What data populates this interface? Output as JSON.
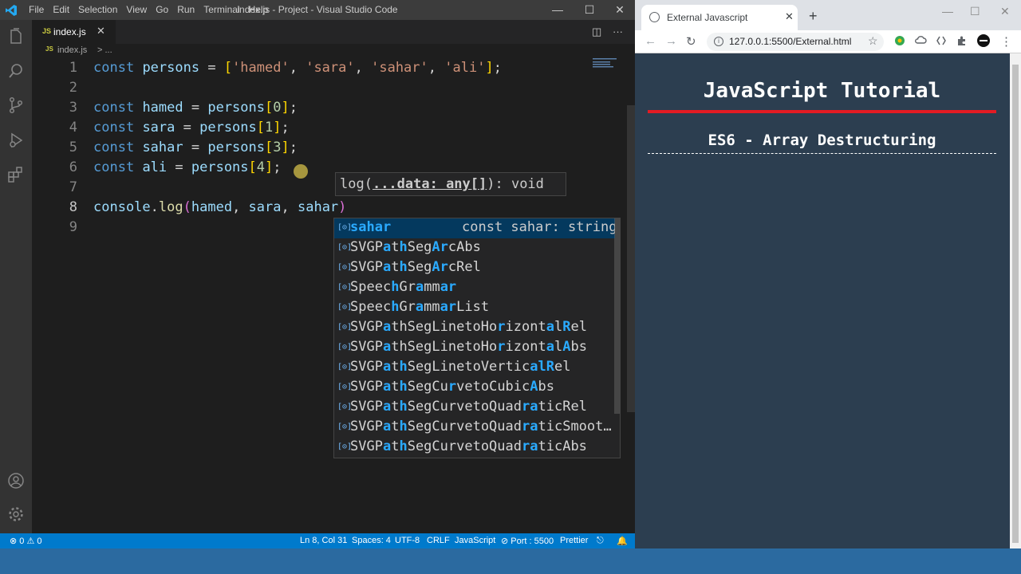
{
  "vscode": {
    "menu": [
      "File",
      "Edit",
      "Selection",
      "View",
      "Go",
      "Run",
      "Terminal",
      "Help"
    ],
    "window_title": "index.js - Project - Visual Studio Code",
    "tab": {
      "icon": "JS",
      "name": "index.js",
      "close": "✕"
    },
    "breadcrumb": {
      "icon": "JS",
      "file": "index.js",
      "sep": "> ..."
    },
    "line_numbers": [
      "1",
      "2",
      "3",
      "4",
      "5",
      "6",
      "7",
      "8",
      "9"
    ],
    "code": {
      "line1": {
        "kw": "const",
        "var": "persons",
        "eq": " = ",
        "open": "[",
        "s1": "'hamed'",
        "s2": "'sara'",
        "s3": "'sahar'",
        "s4": "'ali'",
        "close": "]",
        "end": ";"
      },
      "line3": {
        "kw": "const",
        "var": "hamed",
        "eq": " = ",
        "arr": "persons",
        "ob": "[",
        "idx": "0",
        "cb": "]",
        "end": ";"
      },
      "line4": {
        "kw": "const",
        "var": "sara",
        "eq": " = ",
        "arr": "persons",
        "ob": "[",
        "idx": "1",
        "cb": "]",
        "end": ";"
      },
      "line5": {
        "kw": "const",
        "var": "sahar",
        "eq": " = ",
        "arr": "persons",
        "ob": "[",
        "idx": "3",
        "cb": "]",
        "end": ";"
      },
      "line6": {
        "kw": "const",
        "var": "ali",
        "eq": " = ",
        "arr": "persons",
        "ob": "[",
        "idx": "4",
        "cb": "]",
        "end": ";"
      },
      "line8": {
        "obj": "console",
        "dot": ".",
        "fn": "log",
        "op": "(",
        "a1": "hamed",
        "c1": ", ",
        "a2": "sara",
        "c2": ", ",
        "a3": "sahar",
        "cp": ")"
      }
    },
    "signature_help": {
      "pre": "log(",
      "param": "...data: any[]",
      "post": "): void"
    },
    "suggestions": [
      {
        "parts": [
          [
            "sahar",
            true
          ]
        ],
        "detail": "const sahar: string",
        "selected": true
      },
      {
        "parts": [
          [
            "SVGP",
            false
          ],
          [
            "a",
            true
          ],
          [
            "t",
            false
          ],
          [
            "h",
            true
          ],
          [
            "Seg",
            false
          ],
          [
            "Ar",
            true
          ],
          [
            "cAbs",
            false
          ]
        ]
      },
      {
        "parts": [
          [
            "SVGP",
            false
          ],
          [
            "a",
            true
          ],
          [
            "t",
            false
          ],
          [
            "h",
            true
          ],
          [
            "Seg",
            false
          ],
          [
            "Ar",
            true
          ],
          [
            "cRel",
            false
          ]
        ]
      },
      {
        "parts": [
          [
            "S",
            false
          ],
          [
            "p",
            false
          ],
          [
            "eec",
            false
          ],
          [
            "h",
            true
          ],
          [
            "Gr",
            false
          ],
          [
            "a",
            true
          ],
          [
            "mm",
            false
          ],
          [
            "ar",
            true
          ]
        ]
      },
      {
        "parts": [
          [
            "Speec",
            false
          ],
          [
            "h",
            true
          ],
          [
            "Gr",
            false
          ],
          [
            "a",
            true
          ],
          [
            "mm",
            false
          ],
          [
            "ar",
            true
          ],
          [
            "List",
            false
          ]
        ]
      },
      {
        "parts": [
          [
            "SVGP",
            false
          ],
          [
            "a",
            true
          ],
          [
            "thSegLinetoHo",
            false
          ],
          [
            "r",
            true
          ],
          [
            "izont",
            false
          ],
          [
            "a",
            true
          ],
          [
            "l",
            false
          ],
          [
            "R",
            true
          ],
          [
            "el",
            false
          ]
        ]
      },
      {
        "parts": [
          [
            "SVGP",
            false
          ],
          [
            "a",
            true
          ],
          [
            "thSegLinetoHo",
            false
          ],
          [
            "r",
            true
          ],
          [
            "izont",
            false
          ],
          [
            "a",
            true
          ],
          [
            "l",
            false
          ],
          [
            "A",
            true
          ],
          [
            "bs",
            false
          ]
        ]
      },
      {
        "parts": [
          [
            "SVGP",
            false
          ],
          [
            "a",
            true
          ],
          [
            "t",
            false
          ],
          [
            "h",
            true
          ],
          [
            "SegLinetoVertic",
            false
          ],
          [
            "al",
            true
          ],
          [
            "R",
            true
          ],
          [
            "el",
            false
          ]
        ]
      },
      {
        "parts": [
          [
            "SVGP",
            false
          ],
          [
            "a",
            true
          ],
          [
            "t",
            false
          ],
          [
            "h",
            true
          ],
          [
            "SegCu",
            false
          ],
          [
            "r",
            true
          ],
          [
            "vetoCubic",
            false
          ],
          [
            "A",
            true
          ],
          [
            "bs",
            false
          ]
        ]
      },
      {
        "parts": [
          [
            "SVGP",
            false
          ],
          [
            "a",
            true
          ],
          [
            "t",
            false
          ],
          [
            "h",
            true
          ],
          [
            "SegCurvetoQuad",
            false
          ],
          [
            "r",
            true
          ],
          [
            "a",
            true
          ],
          [
            "ticRel",
            false
          ]
        ]
      },
      {
        "parts": [
          [
            "SVGP",
            false
          ],
          [
            "a",
            true
          ],
          [
            "t",
            false
          ],
          [
            "h",
            true
          ],
          [
            "SegCurvetoQuad",
            false
          ],
          [
            "r",
            true
          ],
          [
            "a",
            true
          ],
          [
            "ticSmoot…",
            false
          ]
        ]
      },
      {
        "parts": [
          [
            "SVGP",
            false
          ],
          [
            "a",
            true
          ],
          [
            "t",
            false
          ],
          [
            "h",
            true
          ],
          [
            "SegCurvetoQuad",
            false
          ],
          [
            "r",
            true
          ],
          [
            "a",
            true
          ],
          [
            "ticAbs",
            false
          ]
        ]
      }
    ],
    "status": {
      "problems": "⊗ 0 ⚠ 0",
      "position": "Ln 8, Col 31",
      "spaces": "Spaces: 4",
      "encoding": "UTF-8",
      "eol": "CRLF",
      "language": "JavaScript",
      "port": "⊘ Port : 5500",
      "prettier": "Prettier"
    }
  },
  "browser": {
    "tab_title": "External Javascript",
    "url": "127.0.0.1:5500/External.html",
    "heading": "JavaScript Tutorial",
    "subheading": "ES6 - Array Destructuring"
  },
  "colors": {
    "vscode_accent": "#007acc",
    "page_bg": "#2c3e50",
    "rule_red": "#e31b23"
  }
}
